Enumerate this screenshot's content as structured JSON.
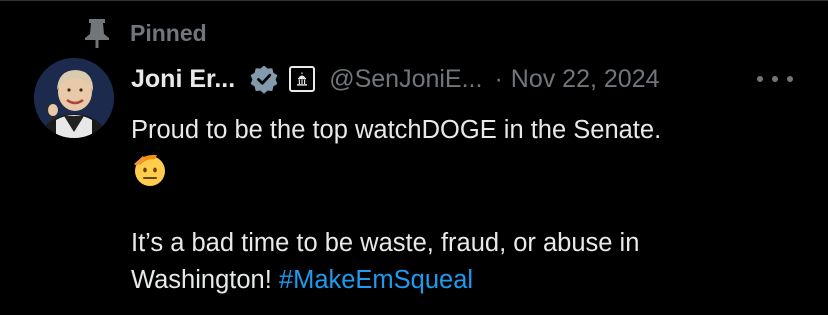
{
  "pinned": {
    "label": "Pinned"
  },
  "author": {
    "display_name": "Joni Er...",
    "handle": "@SenJoniE...",
    "verified": true
  },
  "meta": {
    "separator": "·",
    "date": "Nov 22, 2024"
  },
  "tweet": {
    "line1": "Proud to be the top watchDOGE in the Senate.",
    "emoji": "saluting-face-emoji",
    "line2": "It’s a bad time to be waste, fraud, or abuse in",
    "line3_text": "Washington! ",
    "hashtag": "#MakeEmSqueal"
  },
  "colors": {
    "background": "#000000",
    "text": "#e7e9ea",
    "muted": "#71767b",
    "link": "#1d9bf0",
    "verified_badge": "#829aab"
  }
}
